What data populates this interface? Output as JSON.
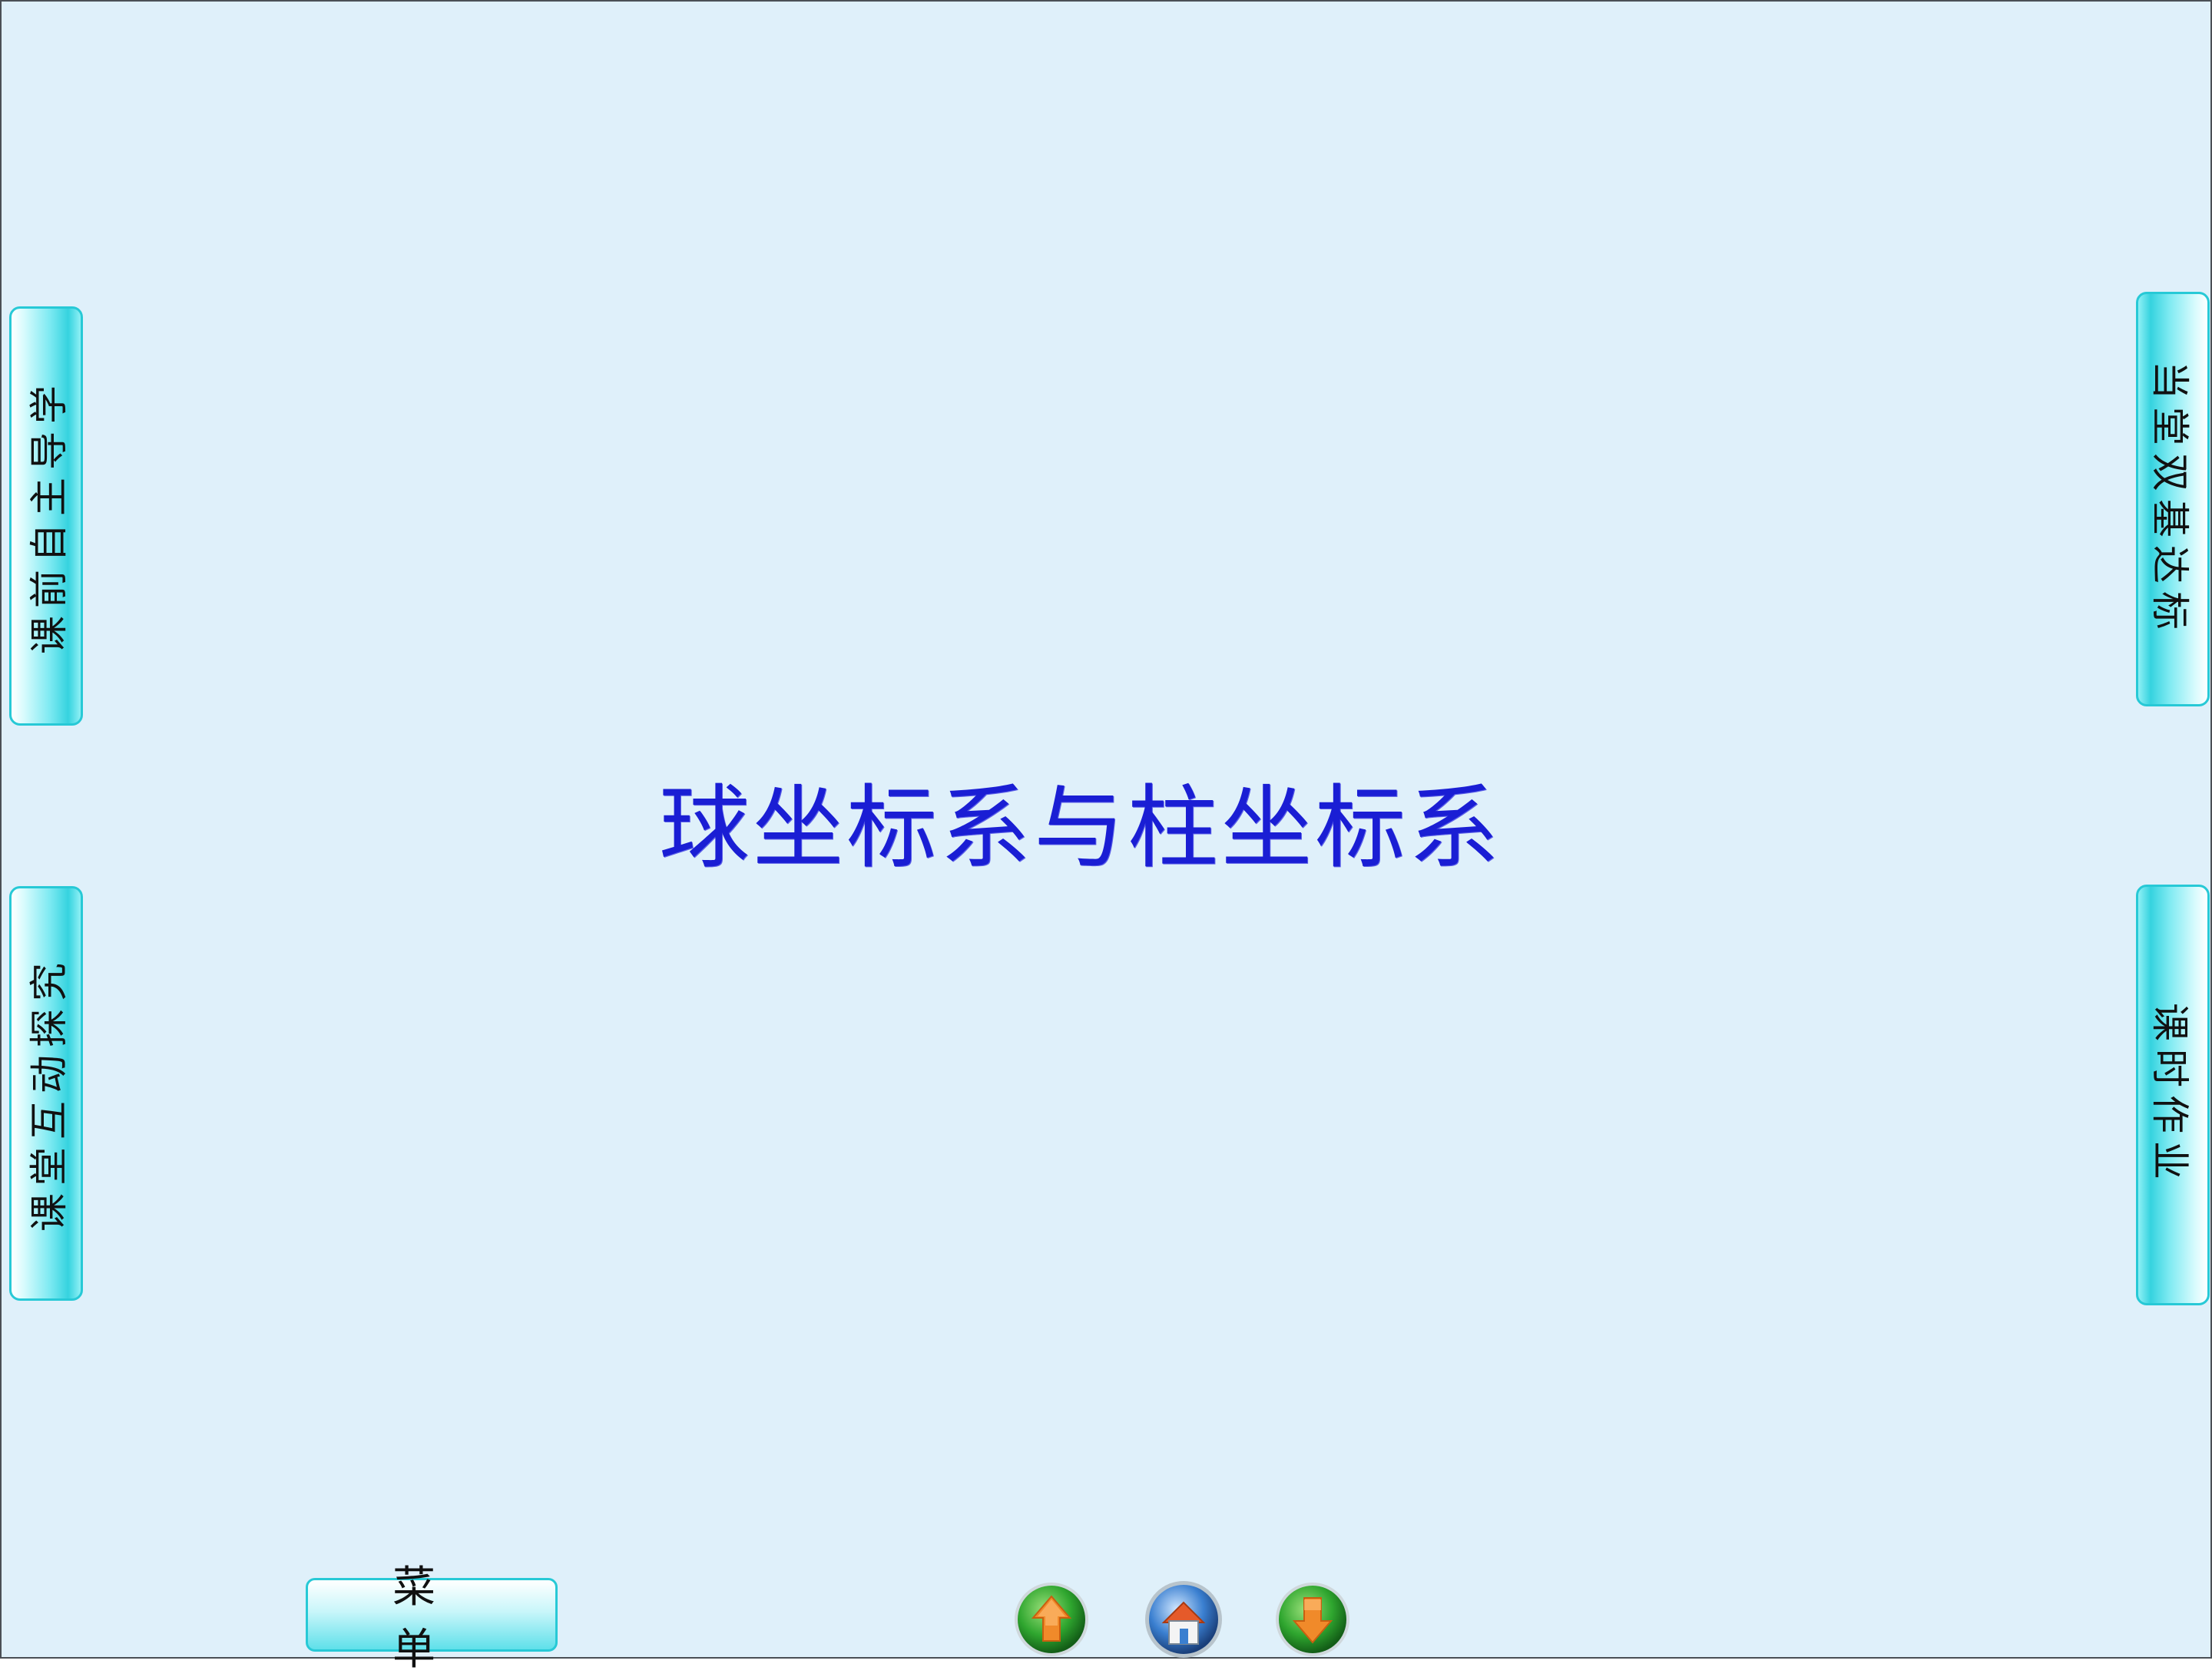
{
  "slide_title": "球坐标系与柱坐标系",
  "left_tabs": [
    {
      "label": "课前自主导学"
    },
    {
      "label": "课堂互动探究"
    }
  ],
  "right_tabs": [
    {
      "label": "当堂双基达标"
    },
    {
      "label": "课时作业"
    }
  ],
  "menu_button": {
    "label": "菜单"
  },
  "nav_buttons": {
    "prev_icon": "arrow-up-icon",
    "home_icon": "home-icon",
    "next_icon": "arrow-down-icon"
  },
  "colors": {
    "background": "#dff0fa",
    "title": "#1a1ed4",
    "tab_border": "#27c9d6",
    "nav_green": "#2fa62f",
    "nav_orange": "#f08a2a",
    "home_blue": "#3a7fd0"
  }
}
